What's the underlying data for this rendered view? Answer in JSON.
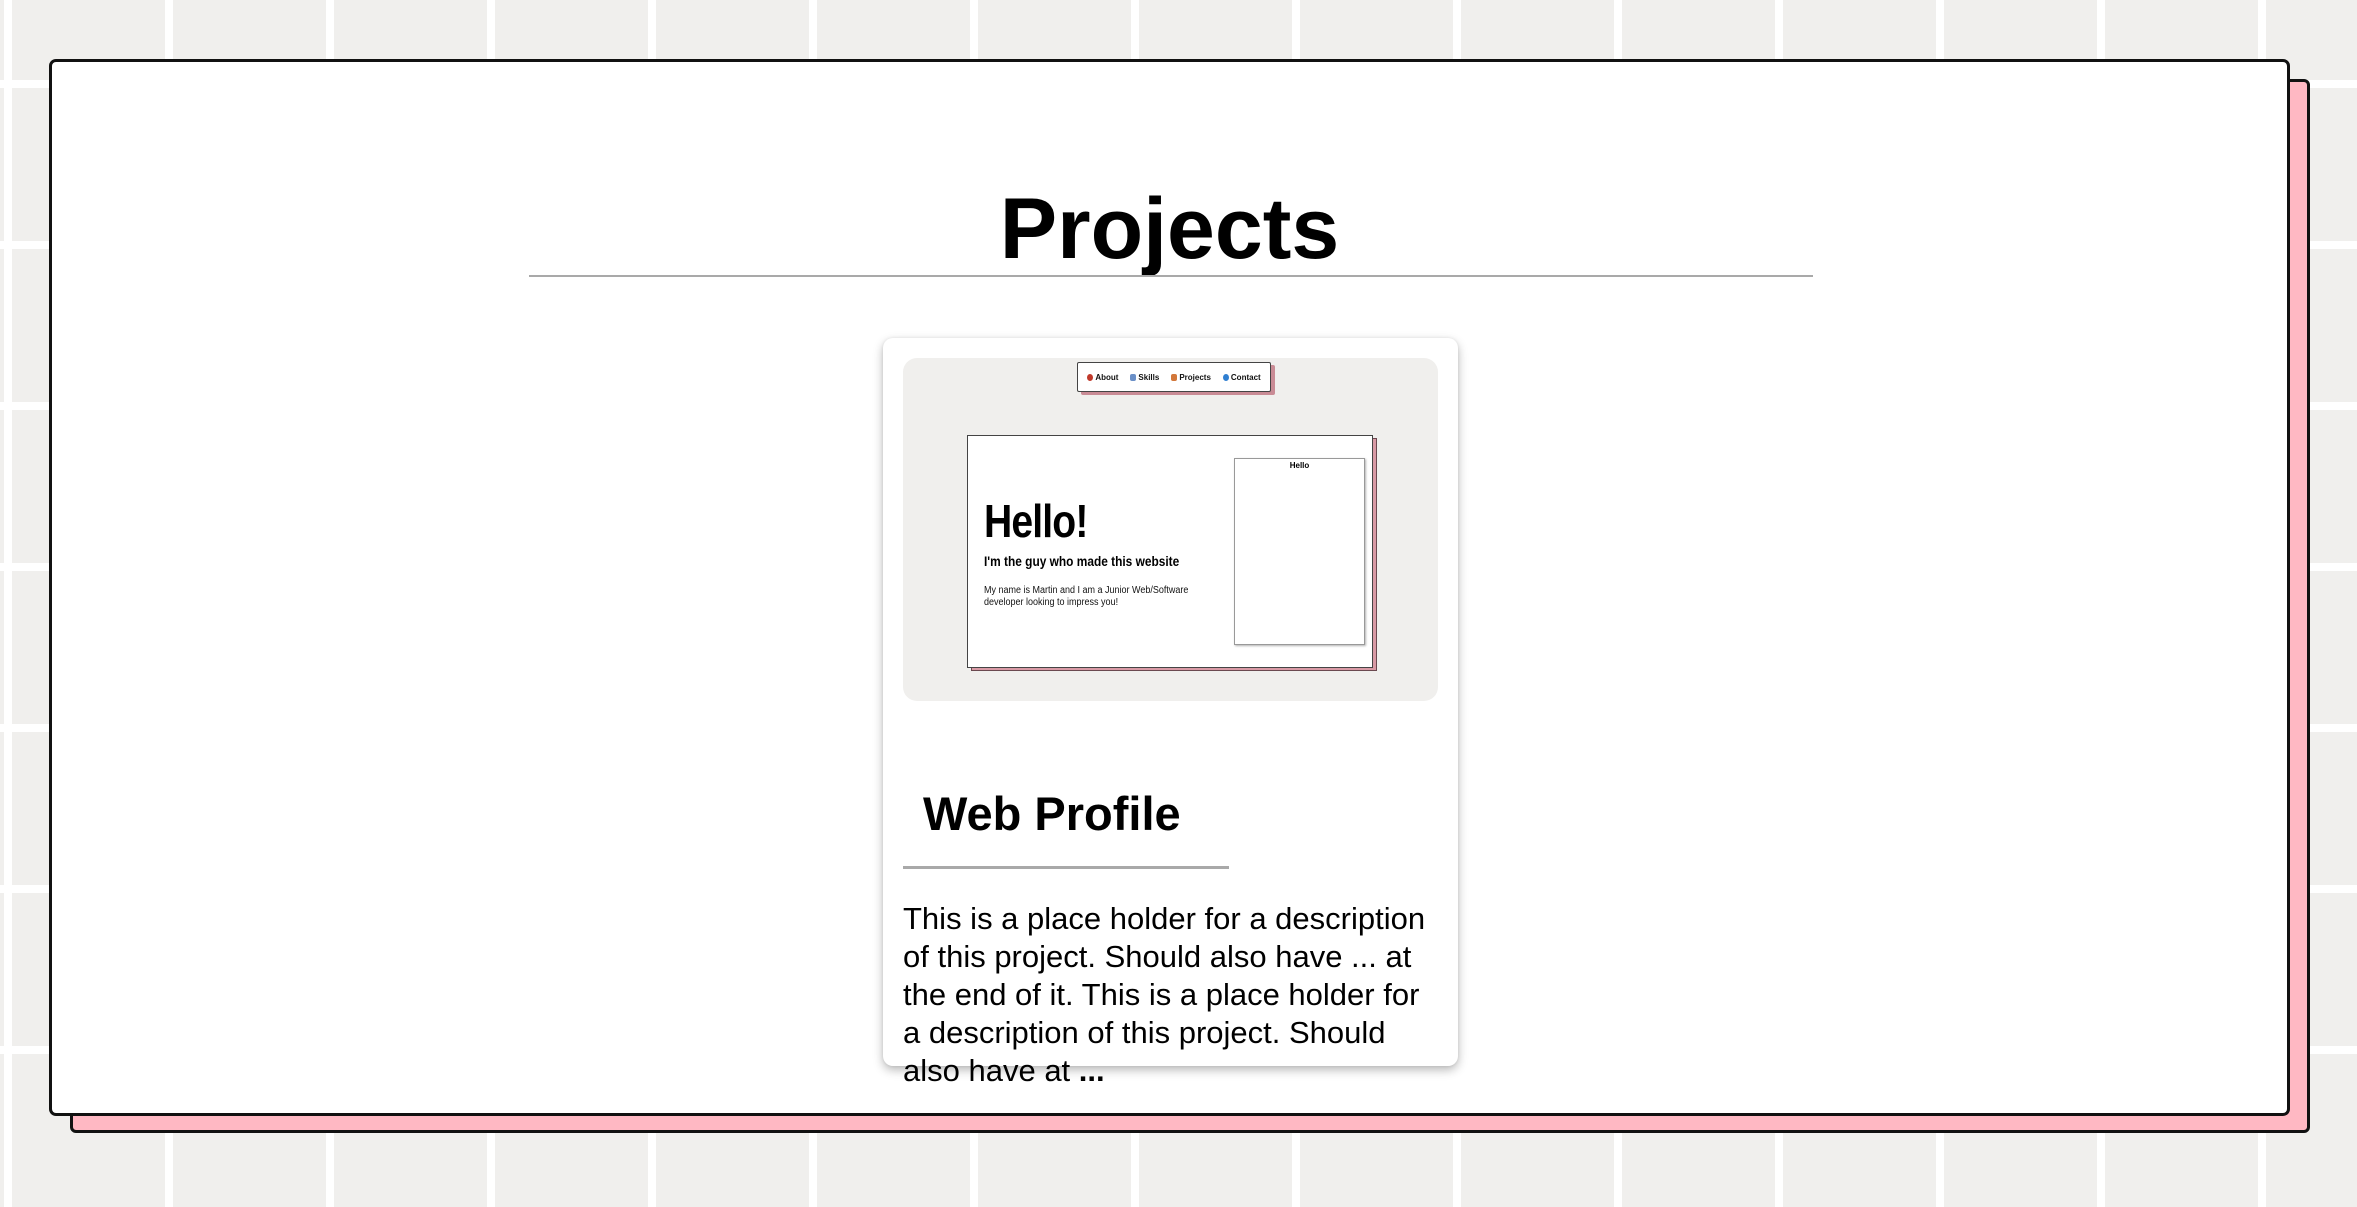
{
  "page": {
    "title": "Projects"
  },
  "project_card": {
    "title": "Web Profile",
    "description": "This is a place holder for a description of this project. Should also have ... at the end of it. This is a place holder for a description of this project. Should also have at",
    "ellipsis": "...",
    "preview": {
      "nav_items": [
        {
          "label": "About",
          "icon": "person-icon",
          "color": "#c0392b"
        },
        {
          "label": "Skills",
          "icon": "document-icon",
          "color": "#6a8fc7"
        },
        {
          "label": "Projects",
          "icon": "briefcase-icon",
          "color": "#d2773a"
        },
        {
          "label": "Contact",
          "icon": "globe-icon",
          "color": "#2f7fd1"
        }
      ],
      "heading": "Hello!",
      "subtitle": "I'm the guy who made this website",
      "body": "My name is Martin and I am a Junior Web/Software developer looking to impress you!",
      "aside_title": "Hello"
    }
  },
  "colors": {
    "background": "#f0efed",
    "panel_shadow": "#ffb8c3",
    "panel": "#ffffff"
  }
}
